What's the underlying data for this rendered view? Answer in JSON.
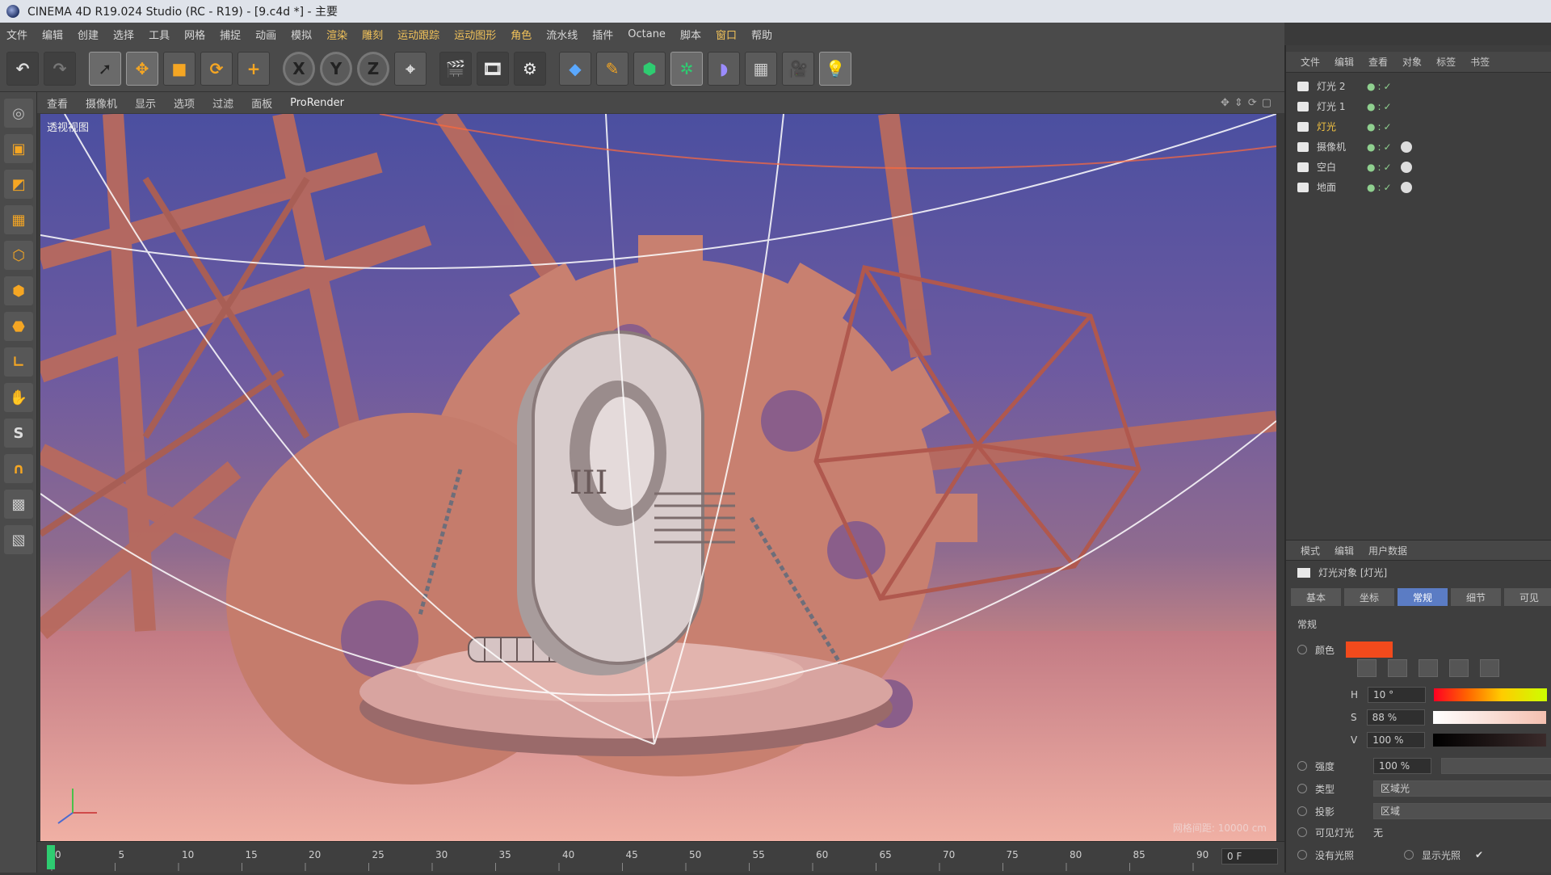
{
  "window": {
    "title": "CINEMA 4D R19.024 Studio (RC - R19) - [9.c4d *] - 主要"
  },
  "menu": [
    "文件",
    "编辑",
    "创建",
    "选择",
    "工具",
    "网格",
    "捕捉",
    "动画",
    "模拟",
    "渲染",
    "雕刻",
    "运动跟踪",
    "运动图形",
    "角色",
    "流水线",
    "插件",
    "Octane",
    "脚本",
    "窗口",
    "帮助"
  ],
  "toolbar": {
    "axis_x": "X",
    "axis_y": "Y",
    "axis_z": "Z"
  },
  "viewport": {
    "menu": [
      "查看",
      "摄像机",
      "显示",
      "选项",
      "过滤",
      "面板",
      "ProRender"
    ],
    "label": "透视视图",
    "status": "网格间距: 10000 cm"
  },
  "timeline": {
    "ticks": [
      "0",
      "5",
      "10",
      "15",
      "20",
      "25",
      "30",
      "35",
      "40",
      "45",
      "50",
      "55",
      "60",
      "65",
      "70",
      "75",
      "80",
      "85",
      "90"
    ],
    "frame_value": "0 F"
  },
  "objects_panel": {
    "tabs": [
      "文件",
      "编辑",
      "查看",
      "对象",
      "标签",
      "书签"
    ],
    "items": [
      {
        "name": "灯光 2",
        "active": false
      },
      {
        "name": "灯光 1",
        "active": false
      },
      {
        "name": "灯光",
        "active": true
      },
      {
        "name": "摄像机",
        "active": false
      },
      {
        "name": "空白",
        "active": false
      },
      {
        "name": "地面",
        "active": false
      }
    ]
  },
  "attributes": {
    "tabs": [
      "模式",
      "编辑",
      "用户数据"
    ],
    "object_title": "灯光对象 [灯光]",
    "subtabs": [
      "基本",
      "坐标",
      "常规",
      "细节",
      "可见"
    ],
    "active_subtab": "常规",
    "section": "常规",
    "color_label": "颜色",
    "color_hex": "#f24a1c",
    "h_label": "H",
    "h_value": "10 °",
    "s_label": "S",
    "s_value": "88 %",
    "v_label": "V",
    "v_value": "100 %",
    "intensity_label": "强度",
    "intensity_value": "100 %",
    "type_label": "类型",
    "type_value": "区域光",
    "shadow_label": "投影",
    "shadow_value": "区域",
    "visible_label": "可见灯光",
    "visible_value": "无",
    "no_light_label": "没有光照",
    "show_light_label": "显示光照"
  }
}
